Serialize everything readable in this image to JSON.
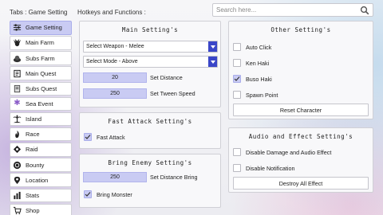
{
  "header": {
    "tabs_title": "Tabs : Game Setting",
    "functions_title": "Hotkeys and Functions :"
  },
  "search": {
    "placeholder": "Search here...",
    "icon": "search-icon"
  },
  "sidebar": {
    "items": [
      {
        "label": "Game Setting",
        "icon": "sliders-icon",
        "active": true
      },
      {
        "label": "Main Farm",
        "icon": "monster-icon"
      },
      {
        "label": "Subs Farm",
        "icon": "subs-farm-icon"
      },
      {
        "label": "Main Quest",
        "icon": "scroll-icon"
      },
      {
        "label": "Subs Quest",
        "icon": "quest-icon"
      },
      {
        "label": "Sea Event",
        "icon": "sparkle-icon"
      },
      {
        "label": "Island",
        "icon": "island-icon"
      },
      {
        "label": "Race",
        "icon": "flame-icon"
      },
      {
        "label": "Raid",
        "icon": "raid-icon"
      },
      {
        "label": "Bounty",
        "icon": "coin-icon"
      },
      {
        "label": "Location",
        "icon": "location-icon"
      },
      {
        "label": "Stats",
        "icon": "stats-icon"
      },
      {
        "label": "Shop",
        "icon": "shop-icon"
      }
    ]
  },
  "main_settings": {
    "title": "Main Setting's",
    "weapon_select": "Select Weapon - Melee",
    "mode_select": "Select Mode - Above",
    "distance_value": "20",
    "distance_label": "Set Distance",
    "tween_value": "250",
    "tween_label": "Set Tween Speed"
  },
  "fast_attack": {
    "title": "Fast Attack Setting's",
    "fast_attack_label": "Fast Attack",
    "fast_attack_checked": true
  },
  "bring_enemy": {
    "title": "Bring Enemy Setting's",
    "distance_value": "250",
    "distance_label": "Set Distance Bring",
    "bring_label": "Bring Monster",
    "bring_checked": true
  },
  "other_settings": {
    "title": "Other Setting's",
    "auto_click_label": "Auto Click",
    "auto_click_checked": false,
    "ken_haki_label": "Ken Haki",
    "ken_haki_checked": false,
    "buso_haki_label": "Buso Haki",
    "buso_haki_checked": true,
    "spawn_point_label": "Spawn Point",
    "spawn_point_checked": false,
    "reset_button": "Reset Character"
  },
  "audio_effect": {
    "title": "Audio and Effect Setting's",
    "disable_damage_label": "Disable Damage and Audio Effect",
    "disable_damage_checked": false,
    "disable_notification_label": "Disable Notification",
    "disable_notification_checked": false,
    "destroy_button": "Destroy All Effect"
  },
  "colors": {
    "accent": "#3a46c8",
    "highlight": "#c9cbf3"
  }
}
